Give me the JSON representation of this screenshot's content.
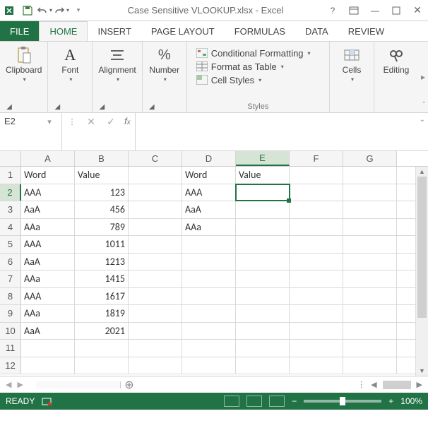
{
  "title": "Case Sensitive VLOOKUP.xlsx - Excel",
  "tabs": {
    "file": "FILE",
    "home": "HOME",
    "insert": "INSERT",
    "page_layout": "PAGE LAYOUT",
    "formulas": "FORMULAS",
    "data": "DATA",
    "review": "REVIEW"
  },
  "ribbon": {
    "clipboard": "Clipboard",
    "font": "Font",
    "alignment": "Alignment",
    "number": "Number",
    "styles_label": "Styles",
    "cond_fmt": "Conditional Formatting",
    "fmt_table": "Format as Table",
    "cell_styles": "Cell Styles",
    "cells": "Cells",
    "editing": "Editing"
  },
  "namebox": "E2",
  "columns": [
    "A",
    "B",
    "C",
    "D",
    "E",
    "F",
    "G"
  ],
  "selected_col": "E",
  "selected_row": 2,
  "row_headers": [
    1,
    2,
    3,
    4,
    5,
    6,
    7,
    8,
    9,
    10,
    11,
    12
  ],
  "rows": [
    {
      "A": "Word",
      "B": "Value",
      "C": "",
      "D": "Word",
      "E": "Value",
      "F": "",
      "G": ""
    },
    {
      "A": "AAA",
      "Bn": 123,
      "C": "",
      "D": "AAA",
      "E": "",
      "F": "",
      "G": ""
    },
    {
      "A": "AaA",
      "Bn": 456,
      "C": "",
      "D": "AaA",
      "E": "",
      "F": "",
      "G": ""
    },
    {
      "A": "AAa",
      "Bn": 789,
      "C": "",
      "D": "AAa",
      "E": "",
      "F": "",
      "G": ""
    },
    {
      "A": "AAA",
      "Bn": 1011,
      "C": "",
      "D": "",
      "E": "",
      "F": "",
      "G": ""
    },
    {
      "A": "AaA",
      "Bn": 1213,
      "C": "",
      "D": "",
      "E": "",
      "F": "",
      "G": ""
    },
    {
      "A": "AAa",
      "Bn": 1415,
      "C": "",
      "D": "",
      "E": "",
      "F": "",
      "G": ""
    },
    {
      "A": "AAA",
      "Bn": 1617,
      "C": "",
      "D": "",
      "E": "",
      "F": "",
      "G": ""
    },
    {
      "A": "AAa",
      "Bn": 1819,
      "C": "",
      "D": "",
      "E": "",
      "F": "",
      "G": ""
    },
    {
      "A": "AaA",
      "Bn": 2021,
      "C": "",
      "D": "",
      "E": "",
      "F": "",
      "G": ""
    },
    {
      "A": "",
      "B": "",
      "C": "",
      "D": "",
      "E": "",
      "F": "",
      "G": ""
    },
    {
      "A": "",
      "B": "",
      "C": "",
      "D": "",
      "E": "",
      "F": "",
      "G": ""
    }
  ],
  "status": {
    "ready": "READY",
    "zoom": "100%"
  }
}
